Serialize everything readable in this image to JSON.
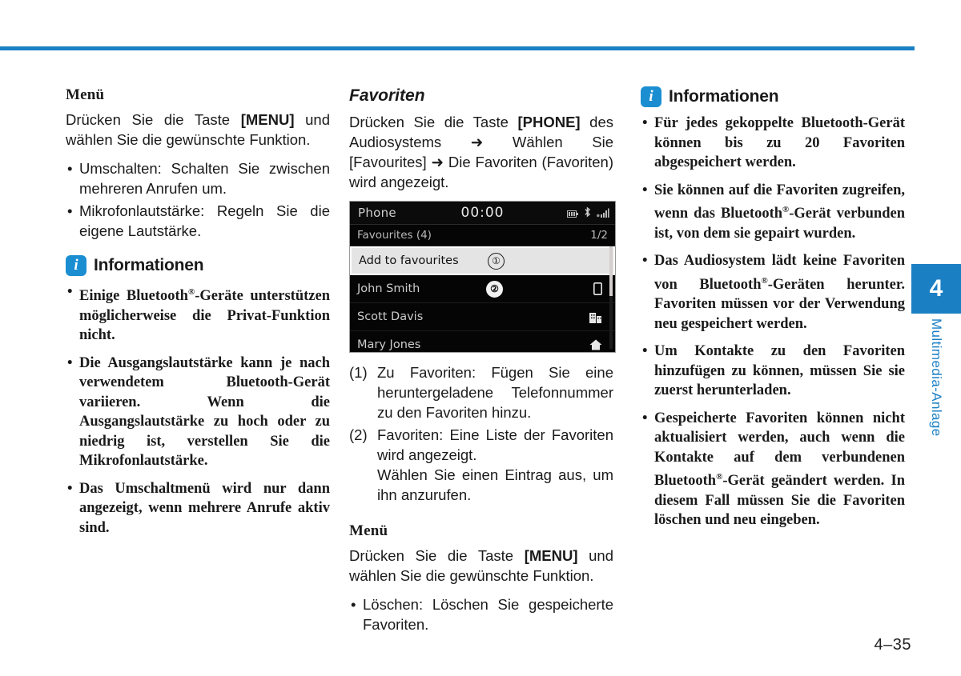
{
  "page": {
    "number": "4–35",
    "chapter_number": "4",
    "chapter_label": "Multimedia-Anlage",
    "accent_color": "#1b7fc4",
    "info_icon_color": "#1b8ed1"
  },
  "column_left": {
    "menu_heading": "Menü",
    "menu_intro_a": "Drücken Sie die Taste ",
    "menu_intro_key": "[MENU]",
    "menu_intro_b": " und wählen Sie die gewünschte Funktion.",
    "menu_bullets": [
      "Umschalten: Schalten Sie zwischen mehreren Anrufen um.",
      "Mikrofonlautstärke: Regeln Sie die eigene Lautstärke."
    ],
    "info": {
      "icon": "info-icon",
      "title": "Informationen",
      "bullets": [
        {
          "pre": "Einige Bluetooth",
          "reg": "®",
          "post": "-Geräte unterstützen möglicherweise die Privat-Funktion nicht."
        },
        {
          "pre": "Die Ausgangslautstärke kann je nach verwendetem Bluetooth-Gerät variieren. Wenn die Ausgangslautstärke zu hoch oder zu niedrig ist, verstellen Sie die Mikrofonlautstärke.",
          "reg": "",
          "post": ""
        },
        {
          "pre": "Das Umschaltmenü wird nur dann angezeigt, wenn mehrere Anrufe aktiv sind.",
          "reg": "",
          "post": ""
        }
      ]
    }
  },
  "column_middle": {
    "favorites_heading": "Favoriten",
    "favorites_intro_a": "Drücken Sie die Taste ",
    "favorites_intro_key": "[PHONE]",
    "favorites_intro_b": " des Audiosystems ",
    "arrow": "➜",
    "favorites_intro_c": " Wählen Sie [Favourites] ",
    "favorites_intro_d": " Die Favoriten (Favoriten) wird angezeigt.",
    "device": {
      "status_title": "Phone",
      "clock": "00:00",
      "status_icons": [
        "battery-icon",
        "bluetooth-icon",
        "signal-icon"
      ],
      "list_title": "Favourites (4)",
      "page_indicator": "1/2",
      "rows": [
        {
          "label": "Add to favourites",
          "callout": "①",
          "icon": "",
          "selected": true
        },
        {
          "label": "John Smith",
          "callout": "②",
          "icon": "mobile-phone-icon",
          "selected": false
        },
        {
          "label": "Scott Davis",
          "callout": "",
          "icon": "office-building-icon",
          "selected": false
        },
        {
          "label": "Mary Jones",
          "callout": "",
          "icon": "home-icon",
          "selected": false
        }
      ]
    },
    "callouts": [
      {
        "num": "(1)",
        "text": "Zu Favoriten: Fügen Sie eine heruntergeladene Telefonnummer zu den Favoriten hinzu.",
        "sub": ""
      },
      {
        "num": "(2)",
        "text": "Favoriten: Eine Liste der Favoriten wird angezeigt.",
        "sub": "Wählen Sie einen Eintrag aus, um ihn anzurufen."
      }
    ],
    "menu_heading": "Menü",
    "menu_intro_a": "Drücken Sie die Taste ",
    "menu_intro_key": "[MENU]",
    "menu_intro_b": " und wählen Sie die gewünschte Funktion.",
    "menu_bullets": [
      "Löschen: Löschen Sie gespeicherte Favoriten."
    ]
  },
  "column_right": {
    "info": {
      "icon": "info-icon",
      "title": "Informationen",
      "bullets": [
        {
          "pre": "Für jedes gekoppelte Bluetooth-Gerät können bis zu 20 Favoriten abgespeichert werden.",
          "reg": "",
          "post": ""
        },
        {
          "pre": "Sie können auf die Favoriten zugreifen, wenn das Bluetooth",
          "reg": "®",
          "post": "-Gerät verbunden ist, von dem sie gepairt wurden."
        },
        {
          "pre": "Das Audiosystem lädt keine Favoriten von Bluetooth",
          "reg": "®",
          "post": "-Geräten herunter. Favoriten müssen vor der Verwendung neu gespeichert werden."
        },
        {
          "pre": "Um Kontakte zu den Favoriten hinzufügen zu können, müssen Sie sie zuerst herunterladen.",
          "reg": "",
          "post": ""
        },
        {
          "pre": "Gespeicherte Favoriten können nicht aktualisiert werden, auch wenn die Kontakte auf dem verbundenen Bluetooth",
          "reg": "®",
          "post": "-Gerät geändert werden. In diesem Fall müssen Sie die Favoriten löschen und neu eingeben."
        }
      ]
    }
  }
}
